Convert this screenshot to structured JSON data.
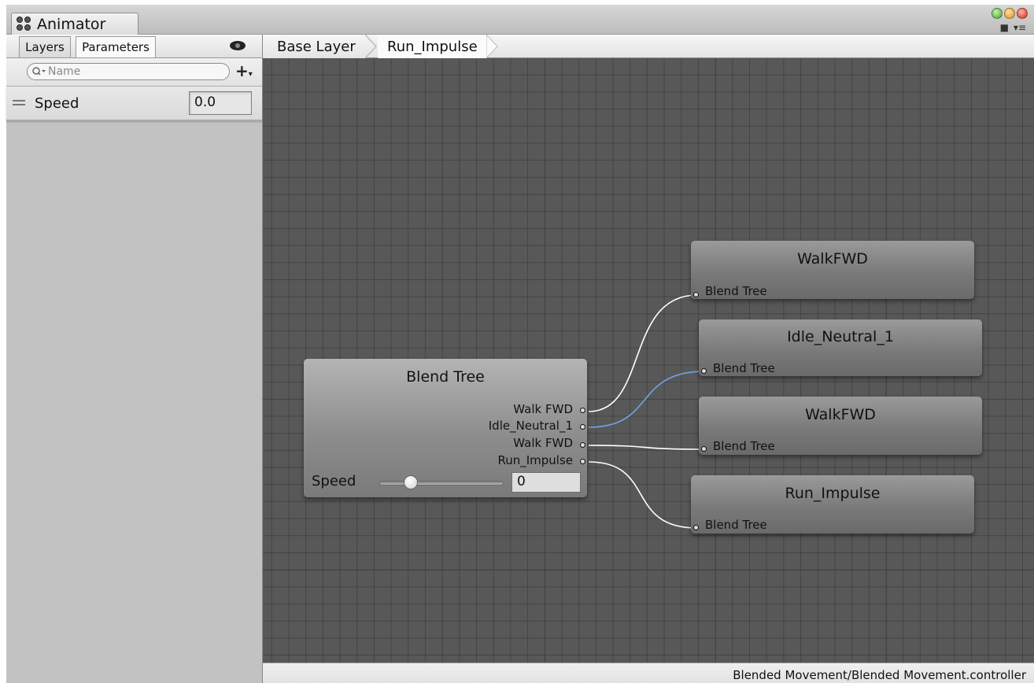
{
  "window": {
    "tab_title": "Animator",
    "status_path": "Blended Movement/Blended Movement.controller"
  },
  "left_panel": {
    "tabs": [
      {
        "label": "Layers"
      },
      {
        "label": "Parameters",
        "active": true
      }
    ],
    "search_placeholder": "Name",
    "parameters": [
      {
        "name": "Speed",
        "value": "0.0"
      }
    ]
  },
  "breadcrumbs": [
    {
      "label": "Base Layer"
    },
    {
      "label": "Run_Impulse"
    }
  ],
  "blend_tree": {
    "title": "Blend Tree",
    "outputs": [
      "Walk FWD",
      "Idle_Neutral_1",
      "Walk FWD",
      "Run_Impulse"
    ],
    "parameter_label": "Speed",
    "parameter_value": "0",
    "slider_position": 0.25
  },
  "motion_nodes": [
    {
      "title": "WalkFWD",
      "input_label": "Blend Tree"
    },
    {
      "title": "Idle_Neutral_1",
      "input_label": "Blend Tree",
      "highlighted": true
    },
    {
      "title": "WalkFWD",
      "input_label": "Blend Tree"
    },
    {
      "title": "Run_Impulse",
      "input_label": "Blend Tree"
    }
  ],
  "colors": {
    "graph_background": "#585858",
    "link_default": "#ffffff",
    "link_selected": "#6fa6e8"
  }
}
